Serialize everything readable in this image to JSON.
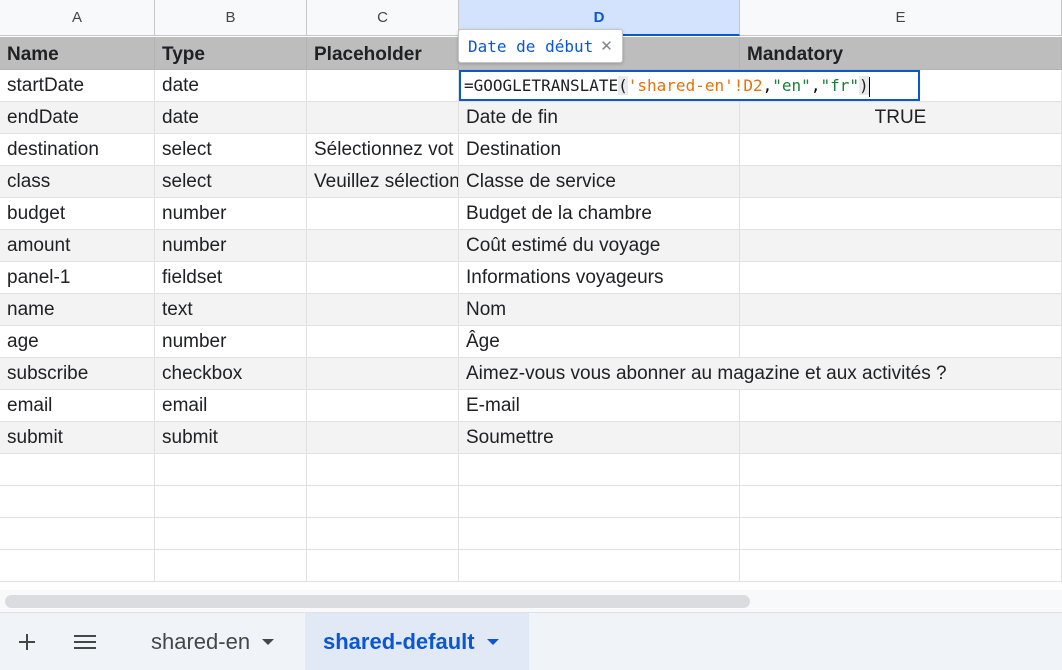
{
  "columns": [
    "A",
    "B",
    "C",
    "D",
    "E"
  ],
  "header_row": [
    "Name",
    "Type",
    "Placeholder",
    "",
    "Mandatory"
  ],
  "rows": [
    [
      "startDate",
      "date",
      "",
      "",
      ""
    ],
    [
      "endDate",
      "date",
      "",
      "Date de fin",
      "TRUE"
    ],
    [
      "destination",
      "select",
      "Sélectionnez vot",
      "Destination",
      ""
    ],
    [
      "class",
      "select",
      "Veuillez sélection",
      "Classe de service",
      ""
    ],
    [
      "budget",
      "number",
      "",
      "Budget de la chambre",
      ""
    ],
    [
      "amount",
      "number",
      "",
      "Coût estimé du voyage",
      ""
    ],
    [
      "panel-1",
      "fieldset",
      "",
      "Informations voyageurs",
      ""
    ],
    [
      "name",
      "text",
      "",
      "Nom",
      ""
    ],
    [
      "age",
      "number",
      "",
      "Âge",
      ""
    ],
    [
      "subscribe",
      "checkbox",
      "",
      "Aimez-vous vous abonner au magazine et aux activités ?",
      ""
    ],
    [
      "email",
      "email",
      "",
      "E-mail",
      ""
    ],
    [
      "submit",
      "submit",
      "",
      "Soumettre",
      ""
    ]
  ],
  "editor": {
    "fn": "=GOOGLETRANSLATE",
    "open_paren": "(",
    "sheet_ref": "'shared-en'",
    "cell_ref": "!D2",
    "comma1": ",",
    "src_lang": "\"en\"",
    "comma2": ",",
    "dst_lang": "\"fr\"",
    "close_paren": ")"
  },
  "tooltip": {
    "text": "Date de début",
    "close_icon": "close-icon"
  },
  "tabs": {
    "add_icon": "plus-icon",
    "menu_icon": "hamburger-menu-icon",
    "sheets": [
      {
        "label": "shared-en",
        "active": false
      },
      {
        "label": "shared-default",
        "active": true
      }
    ]
  },
  "colors": {
    "accent": "#0b57d0",
    "header_bg": "#bdbdbd",
    "alt_row": "#f3f3f3"
  }
}
